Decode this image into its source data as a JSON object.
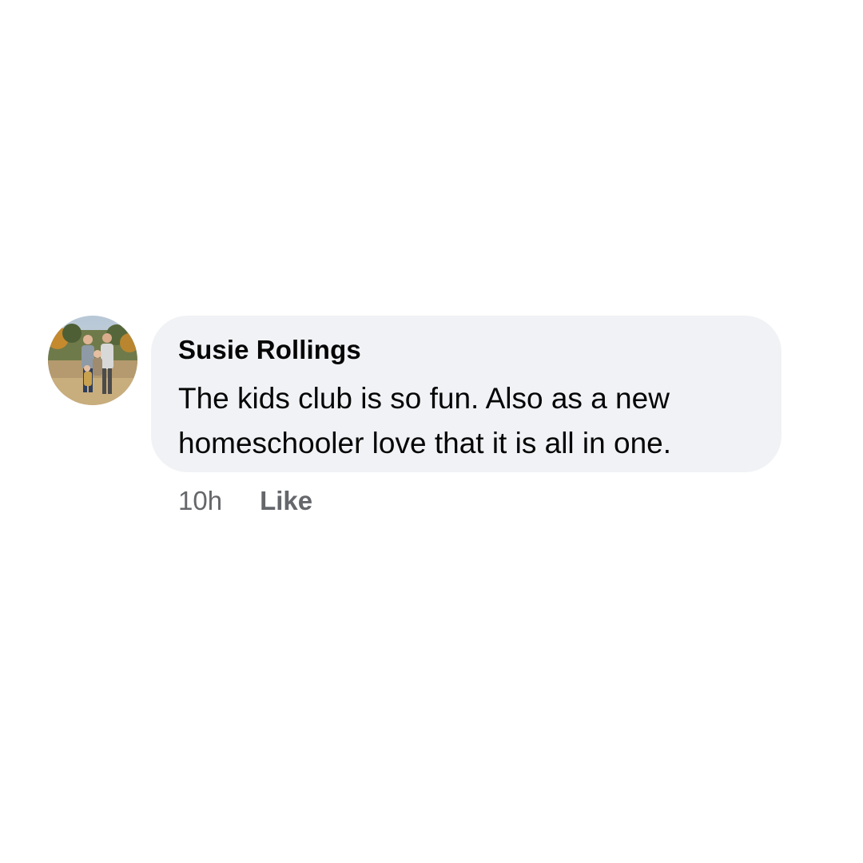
{
  "comment": {
    "author": "Susie Rollings",
    "text": "The kids club is so fun. Also as a new\nhomeschooler love that it is all in one.",
    "timestamp": "10h",
    "like_label": "Like",
    "avatar_icon": "profile-photo-family"
  },
  "colors": {
    "bubble": "#f0f2f5",
    "text": "#050505",
    "meta": "#65676b"
  }
}
